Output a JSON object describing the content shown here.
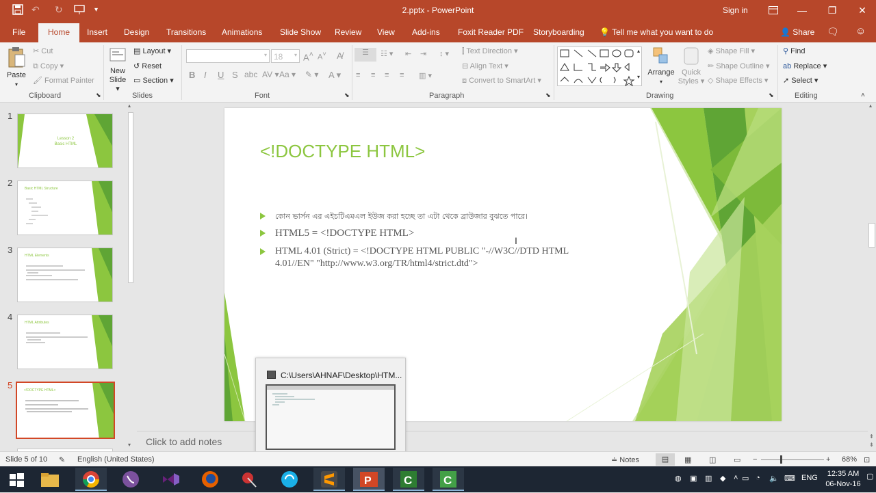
{
  "window": {
    "title": "2.pptx  -  PowerPoint",
    "signin": "Sign in"
  },
  "tabs": [
    "File",
    "Home",
    "Insert",
    "Design",
    "Transitions",
    "Animations",
    "Slide Show",
    "Review",
    "View",
    "Add-ins",
    "Foxit Reader PDF",
    "Storyboarding"
  ],
  "tellme": "Tell me what you want to do",
  "share": "Share",
  "ribbon": {
    "clipboard": {
      "paste": "Paste",
      "cut": "Cut",
      "copy": "Copy",
      "format_painter": "Format Painter",
      "label": "Clipboard"
    },
    "slides": {
      "new_slide": "New",
      "new_slide2": "Slide",
      "layout": "Layout",
      "reset": "Reset",
      "section": "Section",
      "label": "Slides"
    },
    "font": {
      "size": "18",
      "label": "Font"
    },
    "paragraph": {
      "text_direction": "Text Direction",
      "align_text": "Align Text",
      "smartart": "Convert to SmartArt",
      "label": "Paragraph"
    },
    "drawing": {
      "arrange": "Arrange",
      "quick_styles": "Quick",
      "quick_styles2": "Styles",
      "shape_fill": "Shape Fill",
      "shape_outline": "Shape Outline",
      "shape_effects": "Shape Effects",
      "label": "Drawing"
    },
    "editing": {
      "find": "Find",
      "replace": "Replace",
      "select": "Select",
      "label": "Editing"
    }
  },
  "thumbnails": [
    {
      "num": "1",
      "lines": [
        "Lesson 2",
        "Basic HTML"
      ]
    },
    {
      "num": "2",
      "lines": [
        "Basic HTML Structure"
      ]
    },
    {
      "num": "3",
      "lines": [
        "HTML Elements"
      ]
    },
    {
      "num": "4",
      "lines": [
        "HTML Attributes"
      ]
    },
    {
      "num": "5",
      "lines": [
        "<!DOCTYPE HTML>"
      ]
    }
  ],
  "slide": {
    "title": "<!DOCTYPE HTML>",
    "bullets": [
      "কোন ভার্সন এর এইচটিএমএল ইউজ করা হচ্ছে তা এটা থেকে ব্রাউজার বুঝতে পারে।",
      "HTML5 = <!DOCTYPE HTML>",
      "HTML 4.01 (Strict) = <!DOCTYPE HTML PUBLIC \"-//W3C//DTD HTML",
      "4.01//EN\" \"http://www.w3.org/TR/html4/strict.dtd\">"
    ]
  },
  "notes_placeholder": "Click to add notes",
  "preview": {
    "title": "C:\\Users\\AHNAF\\Desktop\\HTM..."
  },
  "status": {
    "slide": "Slide 5 of 10",
    "language": "English (United States)",
    "notes": "Notes",
    "zoom": "68%"
  },
  "tray": {
    "lang": "ENG",
    "time": "12:35 AM",
    "date": "06-Nov-16"
  },
  "colors": {
    "accent": "#b7472a",
    "green": "#8cc63f"
  }
}
